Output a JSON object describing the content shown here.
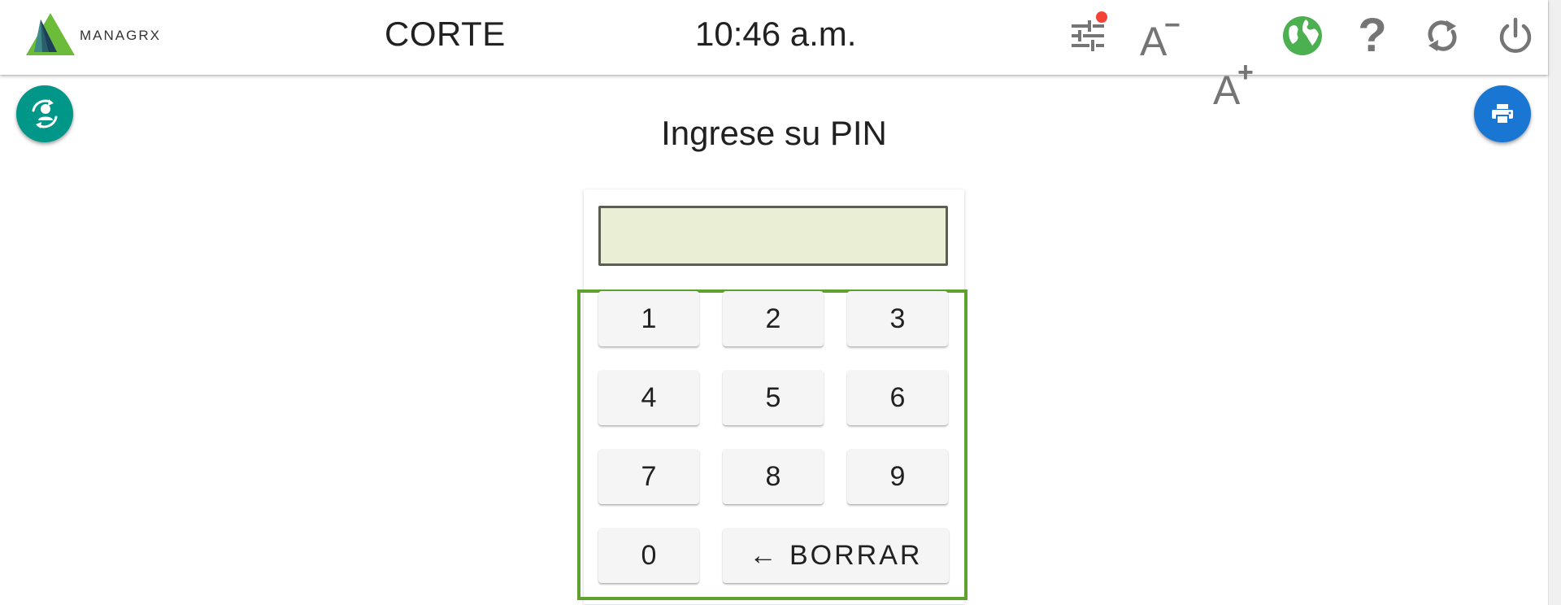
{
  "header": {
    "logo_text": "MANAGRX",
    "title": "CORTE",
    "time": "10:46 a.m.",
    "icons": {
      "filters": "tune-sliders-icon",
      "font_decrease": "font-decrease-icon",
      "font_increase": "font-increase-icon",
      "connection": "globe-status-icon",
      "help": "help-icon",
      "refresh": "refresh-icon",
      "power": "power-icon"
    },
    "font_letter": "A",
    "font_minus": "−",
    "font_plus": "+",
    "help_symbol": "?"
  },
  "colors": {
    "accent_teal": "#009688",
    "accent_blue": "#1976d2",
    "connection_green": "#4caf50",
    "notification_red": "#f44336",
    "keypad_border": "#5ea12e",
    "pin_display_bg": "#eaeed4"
  },
  "main": {
    "prompt": "Ingrese su PIN",
    "pin_value": "",
    "fab_left_icon": "switch-user-icon",
    "fab_right_icon": "print-icon"
  },
  "keypad": {
    "keys": [
      "1",
      "2",
      "3",
      "4",
      "5",
      "6",
      "7",
      "8",
      "9",
      "0"
    ],
    "backspace_label": "← BORRAR"
  }
}
